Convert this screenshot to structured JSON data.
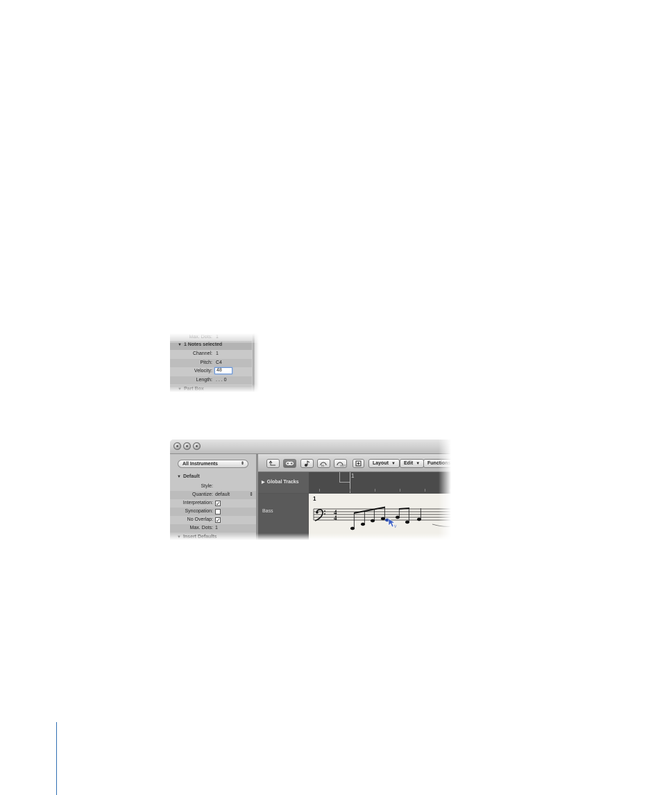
{
  "fig1": {
    "top_partial_label": "Max. Dots:",
    "top_partial_value": "1",
    "section_title": "1 Notes selected",
    "fields": [
      {
        "label": "Channel:",
        "value": "1"
      },
      {
        "label": "Pitch:",
        "value": "C4"
      },
      {
        "label": "Velocity:",
        "value": "48"
      },
      {
        "label": "Length:",
        "value": ". . . 0"
      }
    ],
    "next_section": "Part Box"
  },
  "fig2": {
    "instrument_popup": "All Instruments",
    "default_section": "Default",
    "params": [
      {
        "label": "Style:",
        "value": ""
      },
      {
        "label": "Quantize:",
        "value": "default"
      },
      {
        "label": "Interpretation:",
        "value": "checked"
      },
      {
        "label": "Syncopation:",
        "value": "unchecked"
      },
      {
        "label": "No Overlap:",
        "value": "checked"
      },
      {
        "label": "Max. Dots:",
        "value": "1"
      }
    ],
    "next_section": "Insert Defaults",
    "toolbar": {
      "layout_label": "Layout",
      "edit_label": "Edit",
      "functions_label": "Functions"
    },
    "global_tracks_label": "Global Tracks",
    "ruler_bar": "1",
    "track_name": "Bass",
    "bar_number": "1",
    "time_signature_top": "4",
    "time_signature_bottom": "4",
    "pointer_tool_indicator": "V"
  },
  "colors": {
    "margin_rule": "#2f6fb3",
    "focus_ring": "#6b97d9"
  }
}
